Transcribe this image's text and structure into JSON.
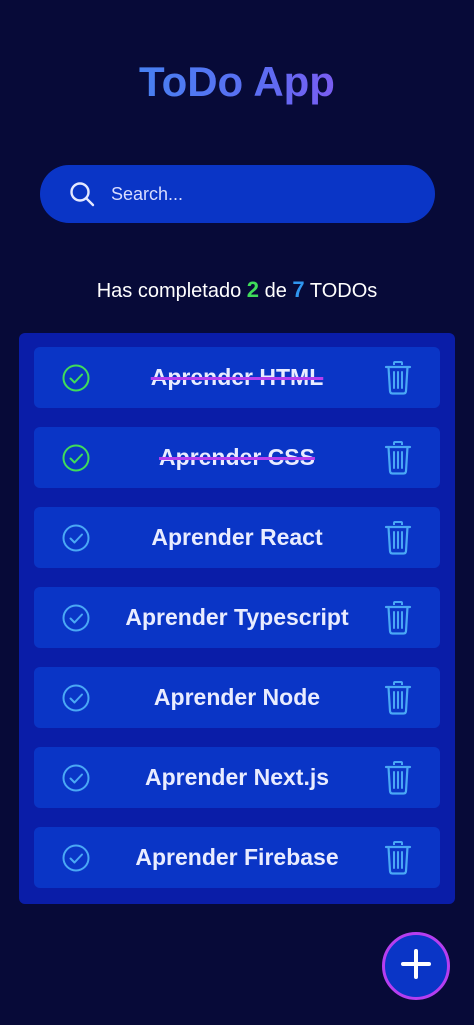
{
  "app": {
    "title": "ToDo App"
  },
  "search": {
    "placeholder": "Search..."
  },
  "counter": {
    "prefix": "Has completado",
    "completed": "2",
    "middle": "de",
    "total": "7",
    "suffix": "TODOs"
  },
  "todos": [
    {
      "text": "Aprender HTML",
      "completed": true
    },
    {
      "text": "Aprender CSS",
      "completed": true
    },
    {
      "text": "Aprender React",
      "completed": false
    },
    {
      "text": "Aprender Typescript",
      "completed": false
    },
    {
      "text": "Aprender Node",
      "completed": false
    },
    {
      "text": "Aprender Next.js",
      "completed": false
    },
    {
      "text": "Aprender Firebase",
      "completed": false
    }
  ],
  "icons": {
    "search": "search-icon",
    "check": "check-circle-icon",
    "delete": "trash-icon",
    "add": "plus-icon"
  },
  "colors": {
    "background": "#070a38",
    "list_background": "#0a1da8",
    "item_background": "#0a35c6",
    "completed_check": "#3fdc5a",
    "pending_check": "#4aa8f5",
    "accent_purple": "#b53ef0",
    "accent_blue": "#2f96f0"
  }
}
